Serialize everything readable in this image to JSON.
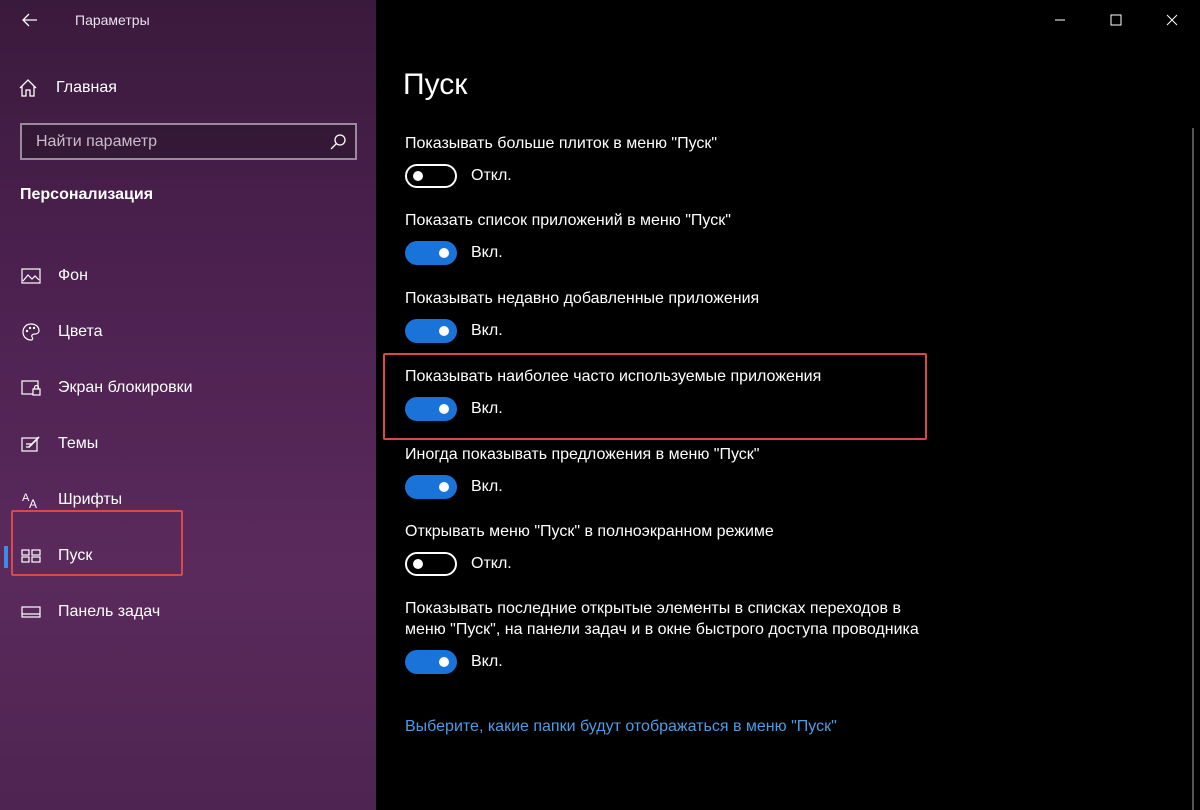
{
  "window": {
    "title": "Параметры",
    "controls": [
      "minimize",
      "maximize",
      "close"
    ]
  },
  "sidebar": {
    "home_label": "Главная",
    "search_placeholder": "Найти параметр",
    "section_title": "Персонализация",
    "items": [
      {
        "label": "Фон",
        "icon": "picture-icon",
        "active": false
      },
      {
        "label": "Цвета",
        "icon": "palette-icon",
        "active": false
      },
      {
        "label": "Экран блокировки",
        "icon": "lock-screen-icon",
        "active": false
      },
      {
        "label": "Темы",
        "icon": "themes-icon",
        "active": false
      },
      {
        "label": "Шрифты",
        "icon": "fonts-icon",
        "active": false
      },
      {
        "label": "Пуск",
        "icon": "start-icon",
        "active": true
      },
      {
        "label": "Панель задач",
        "icon": "taskbar-icon",
        "active": false
      }
    ]
  },
  "main": {
    "title": "Пуск",
    "settings": [
      {
        "label": "Показывать больше плиток в меню \"Пуск\"",
        "on": false,
        "state": "Откл."
      },
      {
        "label": "Показать список приложений в меню \"Пуск\"",
        "on": true,
        "state": "Вкл."
      },
      {
        "label": "Показывать недавно добавленные приложения",
        "on": true,
        "state": "Вкл."
      },
      {
        "label": "Показывать наиболее часто используемые приложения",
        "on": true,
        "state": "Вкл."
      },
      {
        "label": "Иногда показывать предложения в меню \"Пуск\"",
        "on": true,
        "state": "Вкл."
      },
      {
        "label": "Открывать меню \"Пуск\" в полноэкранном режиме",
        "on": false,
        "state": "Откл."
      },
      {
        "label": "Показывать последние открытые элементы в списках переходов в меню \"Пуск\", на панели задач и в окне быстрого доступа проводника",
        "on": true,
        "state": "Вкл."
      }
    ],
    "link": "Выберите, какие папки будут отображаться в меню \"Пуск\""
  },
  "colors": {
    "accent": "#1a73d9",
    "highlight": "#d64a4a",
    "link": "#4a9de6"
  }
}
